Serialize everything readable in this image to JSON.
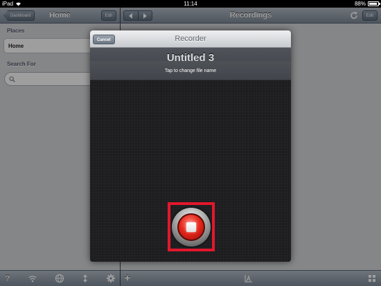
{
  "status_bar": {
    "carrier": "iPad",
    "time": "11:14",
    "battery": "88%"
  },
  "left_pane": {
    "back_label": "Dashboard",
    "title": "Home",
    "edit_label": "Edit",
    "places_heading": "Places",
    "places_item": "Home",
    "search_heading": "Search For",
    "toolbar": {
      "help_glyph": "?",
      "icons": [
        "help-icon",
        "wifi-icon",
        "globe-icon",
        "sort-arrows-icon",
        "gear-icon"
      ]
    }
  },
  "right_pane": {
    "title": "Recordings",
    "edit_label": "Edit",
    "toolbar": {
      "add_glyph": "+",
      "icons": [
        "add-icon",
        "chart-icon",
        "grid-icon"
      ]
    }
  },
  "recorder_modal": {
    "title": "Recorder",
    "cancel_label": "Cancel",
    "file_name": "Untitled 3",
    "hint": "Tap to change file name",
    "record_button_state": "recording",
    "highlight_color": "#e3172c"
  }
}
